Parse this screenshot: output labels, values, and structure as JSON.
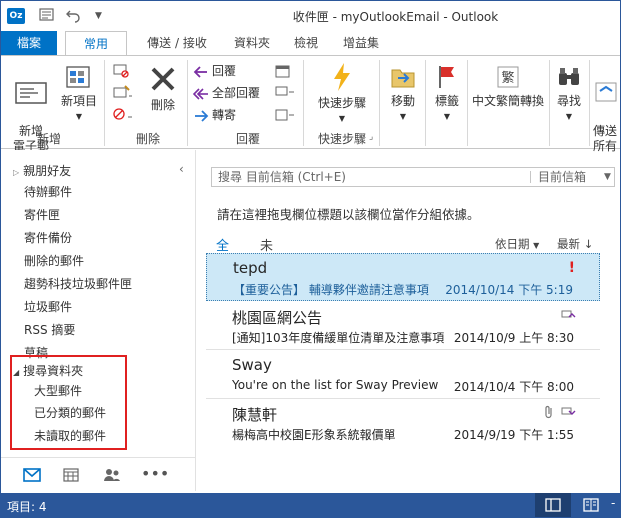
{
  "window": {
    "title": "收件匣 - myOutlookEmail - Outlook",
    "app_badge": "Oz"
  },
  "tabs": [
    {
      "label": "檔案"
    },
    {
      "label": "常用"
    },
    {
      "label": "傳送 / 接收"
    },
    {
      "label": "資料夾"
    },
    {
      "label": "檢視"
    },
    {
      "label": "增益集"
    }
  ],
  "ribbon": {
    "new_email": "新增\n電子郵件",
    "new_items": "新項目",
    "group_new": "新增",
    "delete": "刪除",
    "group_delete": "刪除",
    "reply": "回覆",
    "reply_all": "全部回覆",
    "forward": "轉寄",
    "group_reply": "回覆",
    "quick_steps": "快速步驟",
    "group_quick_steps": "快速步驟",
    "move": "移動",
    "tags": "標籤",
    "convert": "中文繁簡轉換",
    "find": "尋找",
    "send_all": "傳送\n所有"
  },
  "folders": {
    "favorites_header": "親朋好友",
    "items": [
      "待辦郵件",
      "寄件匣",
      "寄件備份",
      "刪除的郵件",
      "趨勢科技垃圾郵件匣",
      "垃圾郵件",
      "RSS 摘要",
      "草稿"
    ],
    "search_header": "搜尋資料夾",
    "search_items": [
      "大型郵件",
      "已分類的郵件",
      "未讀取的郵件"
    ]
  },
  "search": {
    "placeholder": "搜尋 目前信箱 (Ctrl+E)",
    "scope": "目前信箱"
  },
  "list": {
    "group_hint": "請在這裡拖曳欄位標題以該欄位當作分組依據。",
    "filter_all": "全部",
    "filter_unread": "未讀取",
    "sort_by": "依日期",
    "order": "最新"
  },
  "messages": [
    {
      "from": "tepd",
      "subject": "【重要公告】 輔導夥伴邀請注意事項",
      "date": "2014/10/14 下午 5:19",
      "important": true,
      "selected": true
    },
    {
      "from": "桃園區網公告",
      "subject": "[通知]103年度備緩單位清單及注意事項",
      "date": "2014/10/9 上午 8:30",
      "important": false,
      "selected": false
    },
    {
      "from": "Sway",
      "subject": "You're on the list for Sway Preview",
      "date": "2014/10/4 下午 8:00",
      "important": false,
      "selected": false
    },
    {
      "from": "陳慧軒",
      "subject": "楊梅高中校園E形象系統報價單",
      "date": "2014/9/19 下午 1:55",
      "important": false,
      "selected": false
    }
  ],
  "status": {
    "items": "項目: 4"
  },
  "colors": {
    "accent": "#0072c6",
    "status_bar": "#2b579a",
    "selection": "#cde8f7",
    "highlight_box": "#e02020"
  }
}
